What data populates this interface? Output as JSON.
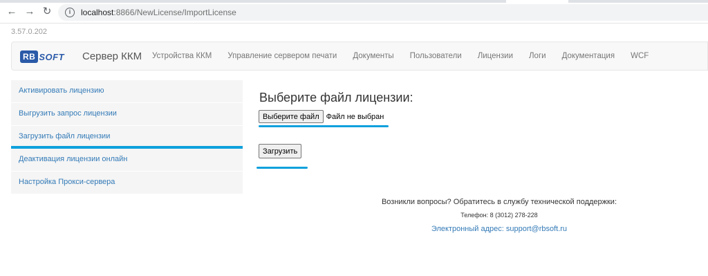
{
  "browser": {
    "back_icon": "arrow-left-icon",
    "forward_icon": "arrow-right-icon",
    "reload_icon": "reload-icon",
    "url_host": "localhost",
    "url_rest": ":8866/NewLicense/ImportLicense"
  },
  "version": "3.57.0.202",
  "navbar": {
    "logo_rb": "RB",
    "logo_soft": "SOFT",
    "brand": "Сервер ККМ",
    "items": [
      {
        "label": "Устройства ККМ"
      },
      {
        "label": "Управление сервером печати"
      },
      {
        "label": "Документы"
      },
      {
        "label": "Пользователи"
      },
      {
        "label": "Лицензии"
      },
      {
        "label": "Логи"
      },
      {
        "label": "Документация"
      },
      {
        "label": "WCF"
      }
    ]
  },
  "sidebar": {
    "items": [
      {
        "label": "Активировать лицензию"
      },
      {
        "label": "Выгрузить запрос лицензии"
      },
      {
        "label": "Загрузить файл лицензии"
      },
      {
        "label": "Деактивация лицензии онлайн"
      },
      {
        "label": "Настройка Прокси-сервера"
      }
    ],
    "active_index": 2
  },
  "main": {
    "heading": "Выберите файл лицензии:",
    "choose_file_label": "Выберите файл",
    "file_status": "Файл не выбран",
    "upload_label": "Загрузить"
  },
  "footer": {
    "question": "Возникли вопросы? Обратитесь в службу технической поддержки:",
    "phone": "Телефон: 8 (3012) 278-228",
    "email": "Электронный адрес: support@rbsoft.ru"
  },
  "colors": {
    "accent": "#0ea0dc",
    "link": "#337ab7"
  }
}
